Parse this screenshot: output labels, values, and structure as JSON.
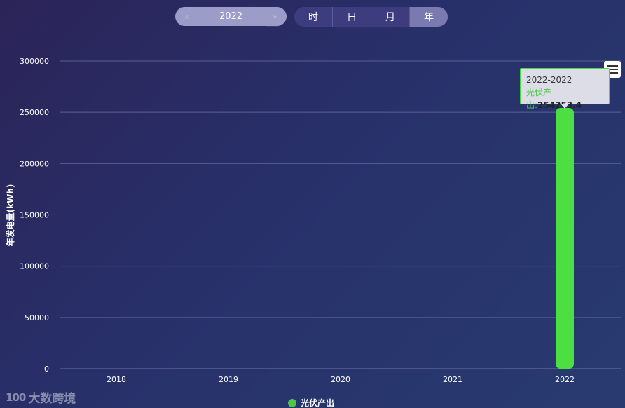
{
  "year_picker": {
    "value": "2022",
    "prev_icon": "chevron-left-icon",
    "next_icon": "chevron-right-icon"
  },
  "period_tabs": [
    {
      "label": "时",
      "active": false
    },
    {
      "label": "日",
      "active": false
    },
    {
      "label": "月",
      "active": false
    },
    {
      "label": "年",
      "active": true
    }
  ],
  "tooltip": {
    "title": "2022-2022",
    "series_label": "光伏产出:",
    "value": "254253.4"
  },
  "legend": {
    "label": "光伏产出",
    "color": "#4bc943"
  },
  "watermark": {
    "logo": "100",
    "text": "大数跨境"
  },
  "chart_data": {
    "type": "bar",
    "categories": [
      "2018",
      "2019",
      "2020",
      "2021",
      "2022"
    ],
    "series": [
      {
        "name": "光伏产出",
        "values": [
          0,
          0,
          0,
          0,
          254253.4
        ],
        "color": "#4bdf42"
      }
    ],
    "ylabel": "年发电量(kWh)",
    "ylim": [
      0,
      300000
    ],
    "yticks": [
      "0",
      "50000",
      "100000",
      "150000",
      "200000",
      "250000",
      "300000"
    ],
    "grid": true,
    "legend_position": "bottom-center"
  }
}
